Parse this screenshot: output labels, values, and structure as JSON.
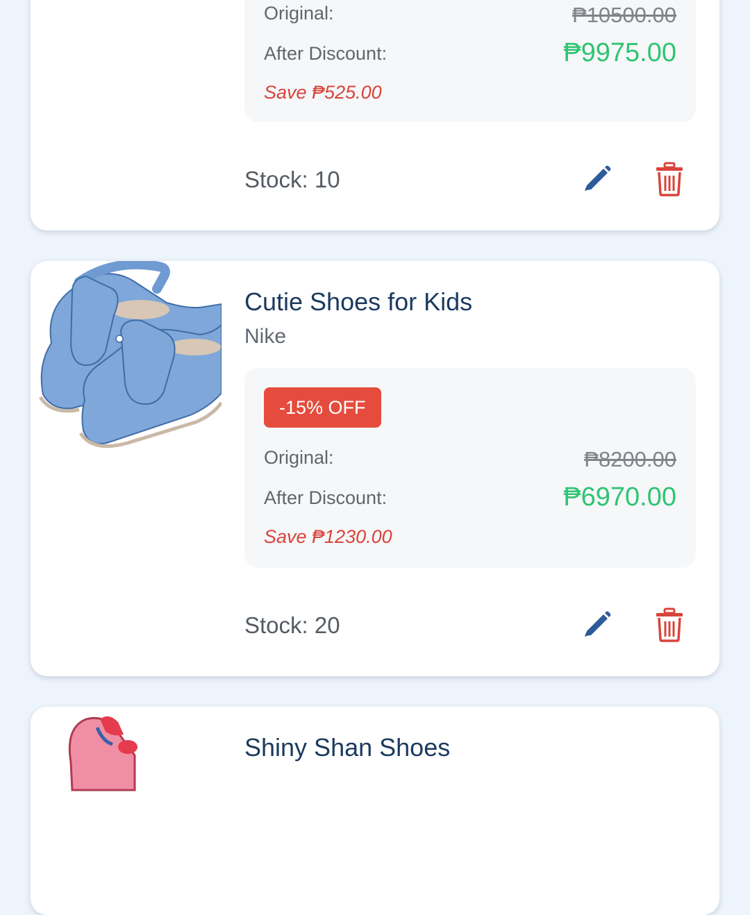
{
  "colors": {
    "page_bg": "#EEF4FB",
    "card_bg": "#FFFFFF",
    "title": "#1B3A5E",
    "discount_badge": "#E54C3D",
    "discounted_price": "#2FC472",
    "save_text": "#D9443A",
    "edit_icon": "#2D5B9A",
    "delete_icon": "#D9443A"
  },
  "products": [
    {
      "name": "",
      "brand": "",
      "badge": "",
      "original_label": "Original:",
      "original_price": "₱10500.00",
      "after_label": "After Discount:",
      "discounted_price": "₱9975.00",
      "save_text": "Save ₱525.00",
      "stock_text": "Stock: 10",
      "edit_icon": "pencil-icon",
      "delete_icon": "trash-icon"
    },
    {
      "name": "Cutie Shoes for Kids",
      "brand": "Nike",
      "badge": "-15% OFF",
      "original_label": "Original:",
      "original_price": "₱8200.00",
      "after_label": "After Discount:",
      "discounted_price": "₱6970.00",
      "save_text": "Save ₱1230.00",
      "stock_text": "Stock: 20",
      "image": "blue-kids-velcro-shoes",
      "edit_icon": "pencil-icon",
      "delete_icon": "trash-icon"
    },
    {
      "name": "Shiny Shan Shoes",
      "image": "shoe-thumbnail"
    }
  ]
}
